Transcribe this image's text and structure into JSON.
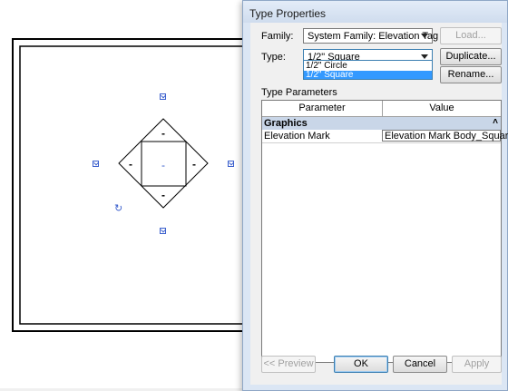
{
  "dialog": {
    "title": "Type Properties",
    "family_label": "Family:",
    "family_value": "System Family: Elevation Tag",
    "type_label": "Type:",
    "type_value": "1/2\" Square",
    "type_options": [
      "1/2\" Circle",
      "1/2\" Square"
    ],
    "type_selected_index": 1,
    "load_button": "Load...",
    "duplicate_button": "Duplicate...",
    "rename_button": "Rename...",
    "type_parameters_label": "Type Parameters",
    "grid": {
      "columns": [
        "Parameter",
        "Value"
      ],
      "groups": [
        {
          "name": "Graphics",
          "rows": [
            {
              "parameter": "Elevation Mark",
              "value": "Elevation Mark Body_Square : D"
            }
          ]
        }
      ]
    },
    "preview_button": "<< Preview",
    "ok_button": "OK",
    "cancel_button": "Cancel",
    "apply_button": "Apply"
  },
  "canvas": {
    "tag_marks": [
      "-",
      "-",
      "-",
      "-"
    ],
    "center_mark": "-",
    "accent_color": "#3a5fcd"
  }
}
